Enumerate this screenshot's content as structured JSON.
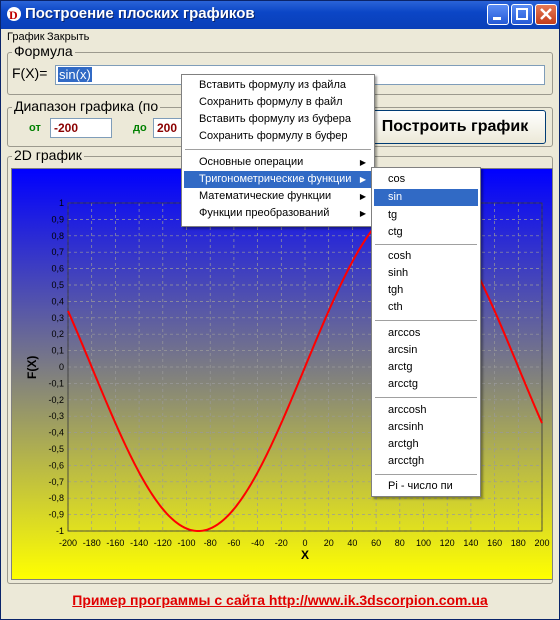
{
  "window": {
    "title": "Построение плоских графиков"
  },
  "menubar": {
    "items": [
      "График",
      "Закрыть"
    ]
  },
  "formula": {
    "legend": "Формула",
    "label": "F(X)=",
    "value": "sin(x)"
  },
  "range": {
    "legend": "Диапазон графика (по",
    "from_label": "от",
    "from_value": "-200",
    "to_label": "до",
    "to_value": "200"
  },
  "build_button": "Построить график",
  "chart_group": {
    "legend": "2D график"
  },
  "colors": {
    "gradient_top": "#0000ff",
    "gradient_bottom": "#ffff00",
    "curve": "#ff0000",
    "accent": "#316ac5"
  },
  "chart_data": {
    "type": "line",
    "x": [
      -200,
      -190,
      -180,
      -170,
      -160,
      -150,
      -140,
      -130,
      -120,
      -110,
      -100,
      -90,
      -80,
      -70,
      -60,
      -50,
      -40,
      -30,
      -20,
      -10,
      0,
      10,
      20,
      30,
      40,
      50,
      60,
      70,
      80,
      90,
      100,
      110,
      120,
      130,
      140,
      150,
      160,
      170,
      180,
      190,
      200
    ],
    "xlabel": "X",
    "ylabel": "F(X)",
    "xlim": [
      -200,
      200
    ],
    "ylim": [
      -1,
      1
    ],
    "xticks": [
      "-200",
      "-180",
      "-160",
      "-140",
      "-120",
      "-100",
      "-80",
      "-60",
      "-40",
      "-20",
      "0",
      "20",
      "40",
      "60",
      "80",
      "100",
      "120",
      "140",
      "160",
      "180",
      "200"
    ],
    "yticks": [
      "1",
      "0,9",
      "0,8",
      "0,7",
      "0,6",
      "0,5",
      "0,4",
      "0,3",
      "0,2",
      "0,1",
      "0",
      "-0,1",
      "-0,2",
      "-0,3",
      "-0,4",
      "-0,5",
      "-0,6",
      "-0,7",
      "-0,8",
      "-0,9",
      "-1"
    ],
    "grid": true
  },
  "context_menu": {
    "items": [
      {
        "label": "Вставить формулу из файла"
      },
      {
        "label": "Сохранить формулу в файл"
      },
      {
        "label": "Вставить формулу из буфера"
      },
      {
        "label": "Сохранить формулу в буфер"
      },
      {
        "label": "Основные операции"
      },
      {
        "label": "Тригонометрические функции"
      },
      {
        "label": "Математические функции"
      },
      {
        "label": "Функции преобразований"
      }
    ]
  },
  "submenu": {
    "items": [
      "cos",
      "sin",
      "tg",
      "ctg",
      "cosh",
      "sinh",
      "tgh",
      "cth",
      "arccos",
      "arcsin",
      "arctg",
      "arcctg",
      "arccosh",
      "arcsinh",
      "arctgh",
      "arcctgh",
      "Pi - число пи"
    ]
  },
  "footer": "Пример программы с сайта http://www.ik.3dscorpion.com.ua"
}
